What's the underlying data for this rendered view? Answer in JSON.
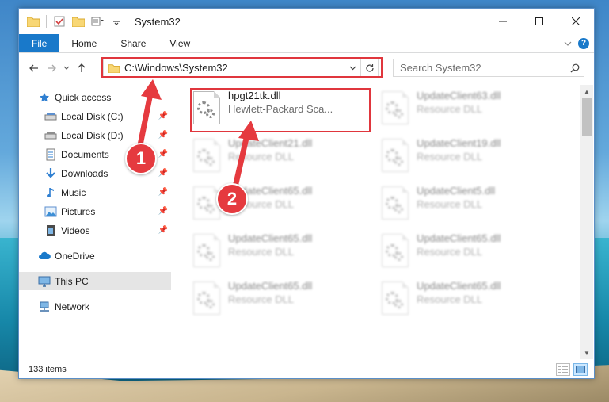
{
  "window": {
    "title": "System32"
  },
  "ribbon": {
    "tabs": [
      "File",
      "Home",
      "Share",
      "View"
    ],
    "help": "?"
  },
  "nav": {
    "address": "C:\\Windows\\System32",
    "search_placeholder": "Search System32"
  },
  "sidebar": {
    "items": [
      {
        "label": "Quick access",
        "icon": "star-icon",
        "pinned": false
      },
      {
        "label": "Local Disk (C:)",
        "icon": "drive-icon",
        "pinned": true
      },
      {
        "label": "Local Disk (D:)",
        "icon": "drive-icon",
        "pinned": true
      },
      {
        "label": "Documents",
        "icon": "documents-icon",
        "pinned": true
      },
      {
        "label": "Downloads",
        "icon": "download-icon",
        "pinned": true
      },
      {
        "label": "Music",
        "icon": "music-icon",
        "pinned": true
      },
      {
        "label": "Pictures",
        "icon": "pictures-icon",
        "pinned": true
      },
      {
        "label": "Videos",
        "icon": "videos-icon",
        "pinned": true
      },
      {
        "label": "OneDrive",
        "icon": "cloud-icon",
        "pinned": false
      },
      {
        "label": "This PC",
        "icon": "computer-icon",
        "pinned": false
      },
      {
        "label": "Network",
        "icon": "network-icon",
        "pinned": false
      }
    ]
  },
  "files": [
    {
      "name": "hpgt21tk.dll",
      "type": "Hewlett-Packard Sca..."
    },
    {
      "name": "UpdateClient63.dll",
      "type": "Resource DLL"
    },
    {
      "name": "UpdateClient21.dll",
      "type": "Resource DLL"
    },
    {
      "name": "UpdateClient19.dll",
      "type": "Resource DLL"
    },
    {
      "name": "UpdateClient65.dll",
      "type": "Resource DLL"
    },
    {
      "name": "UpdateClient5.dll",
      "type": "Resource DLL"
    },
    {
      "name": "UpdateClient65.dll",
      "type": "Resource DLL"
    },
    {
      "name": "UpdateClient65.dll",
      "type": "Resource DLL"
    },
    {
      "name": "UpdateClient65.dll",
      "type": "Resource DLL"
    },
    {
      "name": "UpdateClient65.dll",
      "type": "Resource DLL"
    }
  ],
  "status": {
    "item_count": "133 items"
  },
  "annotations": {
    "badge_1": "1",
    "badge_2": "2"
  },
  "colors": {
    "accent": "#1979ca",
    "highlight": "#e0363d",
    "selected": "#cce8ff"
  }
}
